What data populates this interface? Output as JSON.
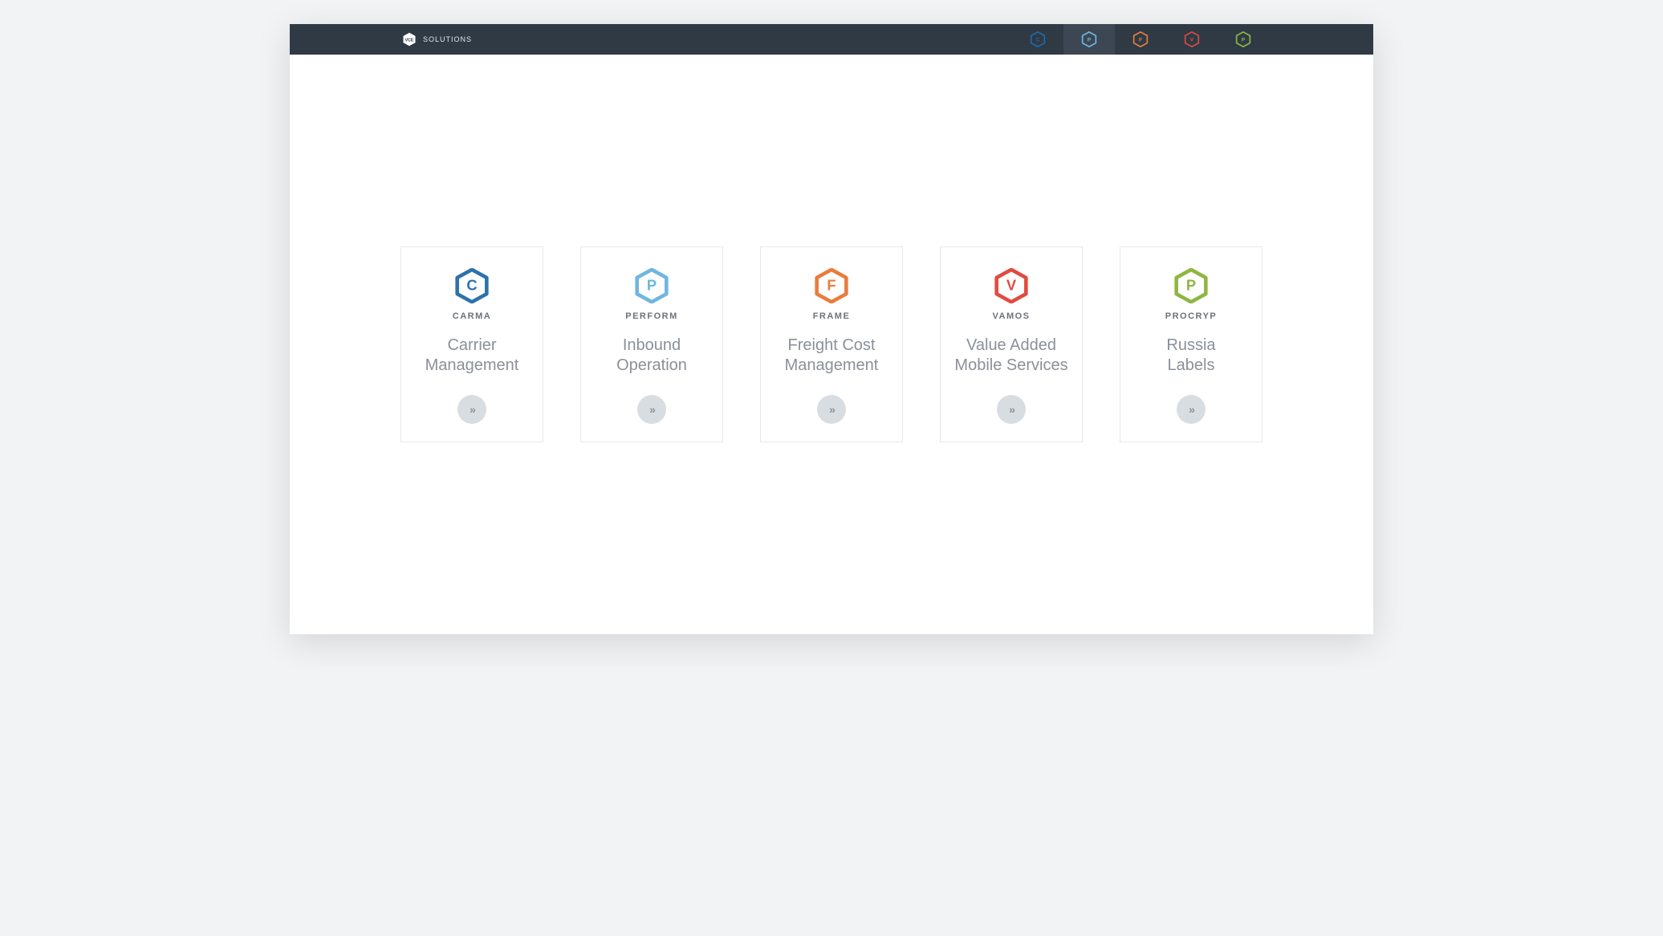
{
  "brand": {
    "logo_letter": "VCE",
    "name": "SOLUTIONS"
  },
  "nav": {
    "items": [
      {
        "letter": "C",
        "color": "#1f6aa8",
        "active": false
      },
      {
        "letter": "P",
        "color": "#6fb6e0",
        "active": true
      },
      {
        "letter": "F",
        "color": "#e97c3c",
        "active": false
      },
      {
        "letter": "V",
        "color": "#d94b3f",
        "active": false
      },
      {
        "letter": "P",
        "color": "#8fb642",
        "active": false
      }
    ]
  },
  "cards": [
    {
      "letter": "C",
      "color": "#2d72ab",
      "code": "CARMA",
      "title_line1": "Carrier",
      "title_line2": "Management"
    },
    {
      "letter": "P",
      "color": "#6fb6e0",
      "code": "PERFORM",
      "title_line1": "Inbound",
      "title_line2": "Operation"
    },
    {
      "letter": "F",
      "color": "#e97c3c",
      "code": "FRAME",
      "title_line1": "Freight Cost",
      "title_line2": "Management"
    },
    {
      "letter": "V",
      "color": "#e14b3f",
      "code": "VAMOS",
      "title_line1": "Value Added",
      "title_line2": "Mobile Services"
    },
    {
      "letter": "P",
      "color": "#8fb642",
      "code": "PROCRYP",
      "title_line1": "Russia",
      "title_line2": "Labels"
    }
  ]
}
